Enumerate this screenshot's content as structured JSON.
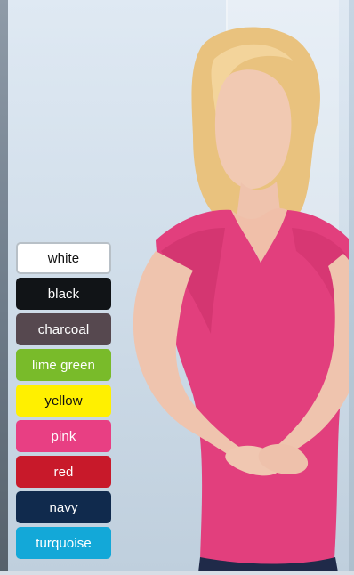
{
  "swatches": [
    {
      "label": "white",
      "color": "#ffffff"
    },
    {
      "label": "black",
      "color": "#111417"
    },
    {
      "label": "charcoal",
      "color": "#56484f"
    },
    {
      "label": "lime green",
      "color": "#79bb2a"
    },
    {
      "label": "yellow",
      "color": "#fff000"
    },
    {
      "label": "pink",
      "color": "#e83f83"
    },
    {
      "label": "red",
      "color": "#c8192a"
    },
    {
      "label": "navy",
      "color": "#102a4d"
    },
    {
      "label": "turquoise",
      "color": "#13a8d8"
    }
  ]
}
